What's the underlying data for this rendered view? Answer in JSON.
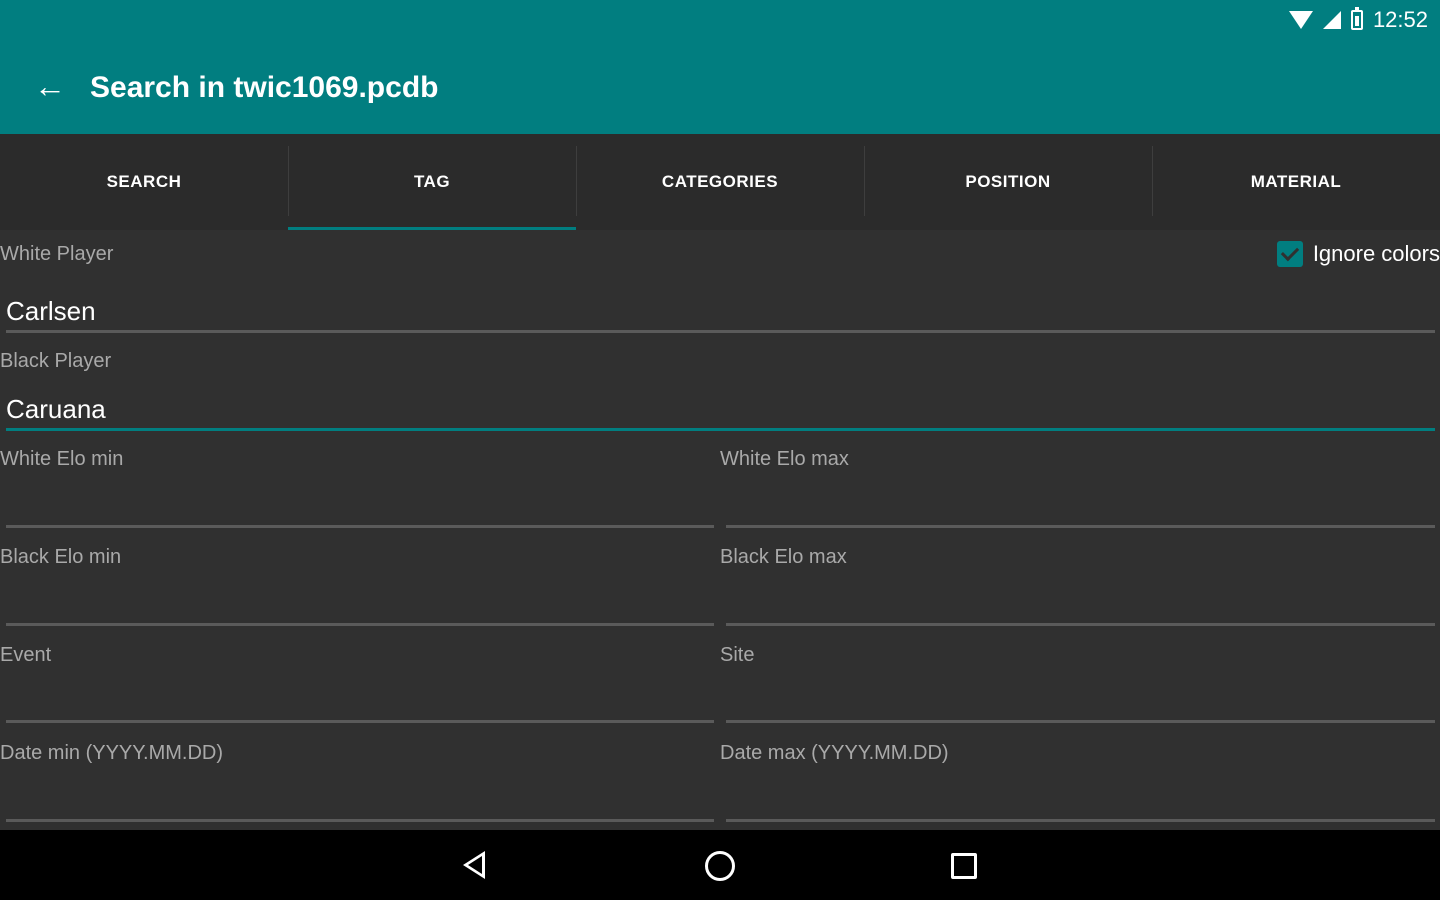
{
  "status_bar": {
    "time": "12:52"
  },
  "app_bar": {
    "title": "Search in twic1069.pcdb"
  },
  "tabs": [
    {
      "label": "SEARCH",
      "active": false
    },
    {
      "label": "TAG",
      "active": true
    },
    {
      "label": "CATEGORIES",
      "active": false
    },
    {
      "label": "POSITION",
      "active": false
    },
    {
      "label": "MATERIAL",
      "active": false
    }
  ],
  "form": {
    "white_player": {
      "label": "White Player",
      "value": "Carlsen"
    },
    "ignore_colors": {
      "label": "Ignore colors",
      "checked": true
    },
    "black_player": {
      "label": "Black Player",
      "value": "Caruana"
    },
    "white_elo_min": {
      "label": "White Elo min",
      "value": ""
    },
    "white_elo_max": {
      "label": "White Elo max",
      "value": ""
    },
    "black_elo_min": {
      "label": "Black Elo min",
      "value": ""
    },
    "black_elo_max": {
      "label": "Black Elo max",
      "value": ""
    },
    "event": {
      "label": "Event",
      "value": ""
    },
    "site": {
      "label": "Site",
      "value": ""
    },
    "date_min": {
      "label": "Date min (YYYY.MM.DD)",
      "value": ""
    },
    "date_max": {
      "label": "Date max (YYYY.MM.DD)",
      "value": ""
    }
  },
  "colors": {
    "accent": "#017e80",
    "background": "#303030"
  }
}
